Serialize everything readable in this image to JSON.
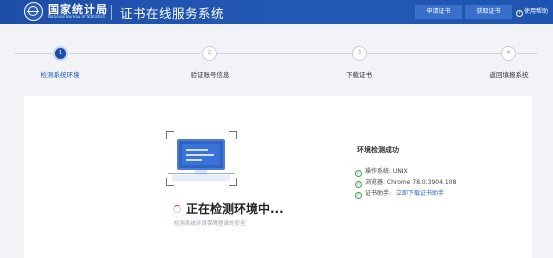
{
  "header": {
    "org_name_cn": "国家统计局",
    "org_name_en": "National Bureau of Statistics",
    "system_title": "证书在线服务系统",
    "buttons": [
      "申请证书",
      "获取证书"
    ],
    "help": "使用帮助"
  },
  "steps": [
    {
      "number": "1",
      "label": "检测系统环境",
      "active": true
    },
    {
      "number": "2",
      "label": "验证账号信息",
      "active": false
    },
    {
      "number": "3",
      "label": "下载证书",
      "active": false
    },
    {
      "number": "4",
      "label": "返回填报系统",
      "active": false
    }
  ],
  "detection": {
    "status_title": "正在检测环境中...",
    "status_subtitle": "检测系统环境保障登录的安全"
  },
  "result": {
    "title": "环境检测成功",
    "rows": [
      {
        "label": "操作系统: UNIX"
      },
      {
        "label": "浏览器: Chrome 78.0.3904.108"
      },
      {
        "label": "证书助手: ",
        "link": "立即下载证书助手"
      }
    ]
  },
  "colors": {
    "header_blue": "#1d4fa8",
    "active_step": "#1b4ea4",
    "success_green": "#39a84a",
    "link_blue": "#2b67d1"
  }
}
